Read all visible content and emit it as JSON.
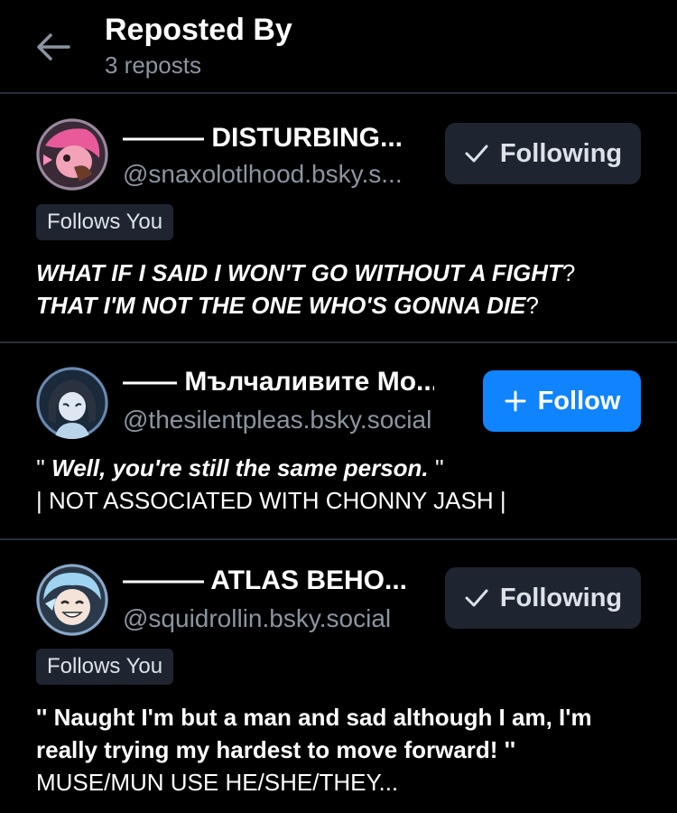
{
  "header": {
    "title": "Reposted By",
    "subtitle": "3 reposts",
    "back_icon": "arrow-left-icon"
  },
  "users": [
    {
      "display_name": "——— DISTURBING...",
      "handle": "@snaxolotlhood.bsky.s...",
      "button_label": "Following",
      "button_icon": "check-icon",
      "follows_you": "Follows You",
      "bio": [
        {
          "parts": [
            {
              "text": "WHAT IF I SAID I WON'T GO WITHOUT A FIGHT",
              "style": "bi"
            },
            {
              "text": "?",
              "style": ""
            }
          ]
        },
        {
          "parts": [
            {
              "text": "THAT I'M NOT THE ONE WHO'S GONNA DIE",
              "style": "bi"
            },
            {
              "text": "?",
              "style": ""
            }
          ]
        }
      ]
    },
    {
      "display_name": "—— Мълчаливите Мо...",
      "handle": "@thesilentpleas.bsky.social",
      "button_label": "Follow",
      "button_icon": "plus-icon",
      "bio": [
        {
          "parts": [
            {
              "text": "'' ",
              "style": ""
            },
            {
              "text": "Well, you're still the same person.",
              "style": "bi"
            },
            {
              "text": " ''",
              "style": ""
            }
          ]
        },
        {
          "parts": [
            {
              "text": "| NOT ASSOCIATED WITH CHONNY JASH |",
              "style": ""
            }
          ]
        }
      ]
    },
    {
      "display_name": "——— ATLAS BEHO...",
      "handle": "@squidrollin.bsky.social",
      "button_label": "Following",
      "button_icon": "check-icon",
      "follows_you": "Follows You",
      "bio": [
        {
          "parts": [
            {
              "text": "'' Naught I'm but a man and sad although I am, I'm",
              "style": "b"
            }
          ]
        },
        {
          "parts": [
            {
              "text": "really trying my hardest to move forward! ''",
              "style": "b"
            }
          ]
        },
        {
          "parts": [
            {
              "text": "MUSE/MUN USE HE/SHE/THEY...",
              "style": ""
            }
          ]
        }
      ]
    }
  ]
}
